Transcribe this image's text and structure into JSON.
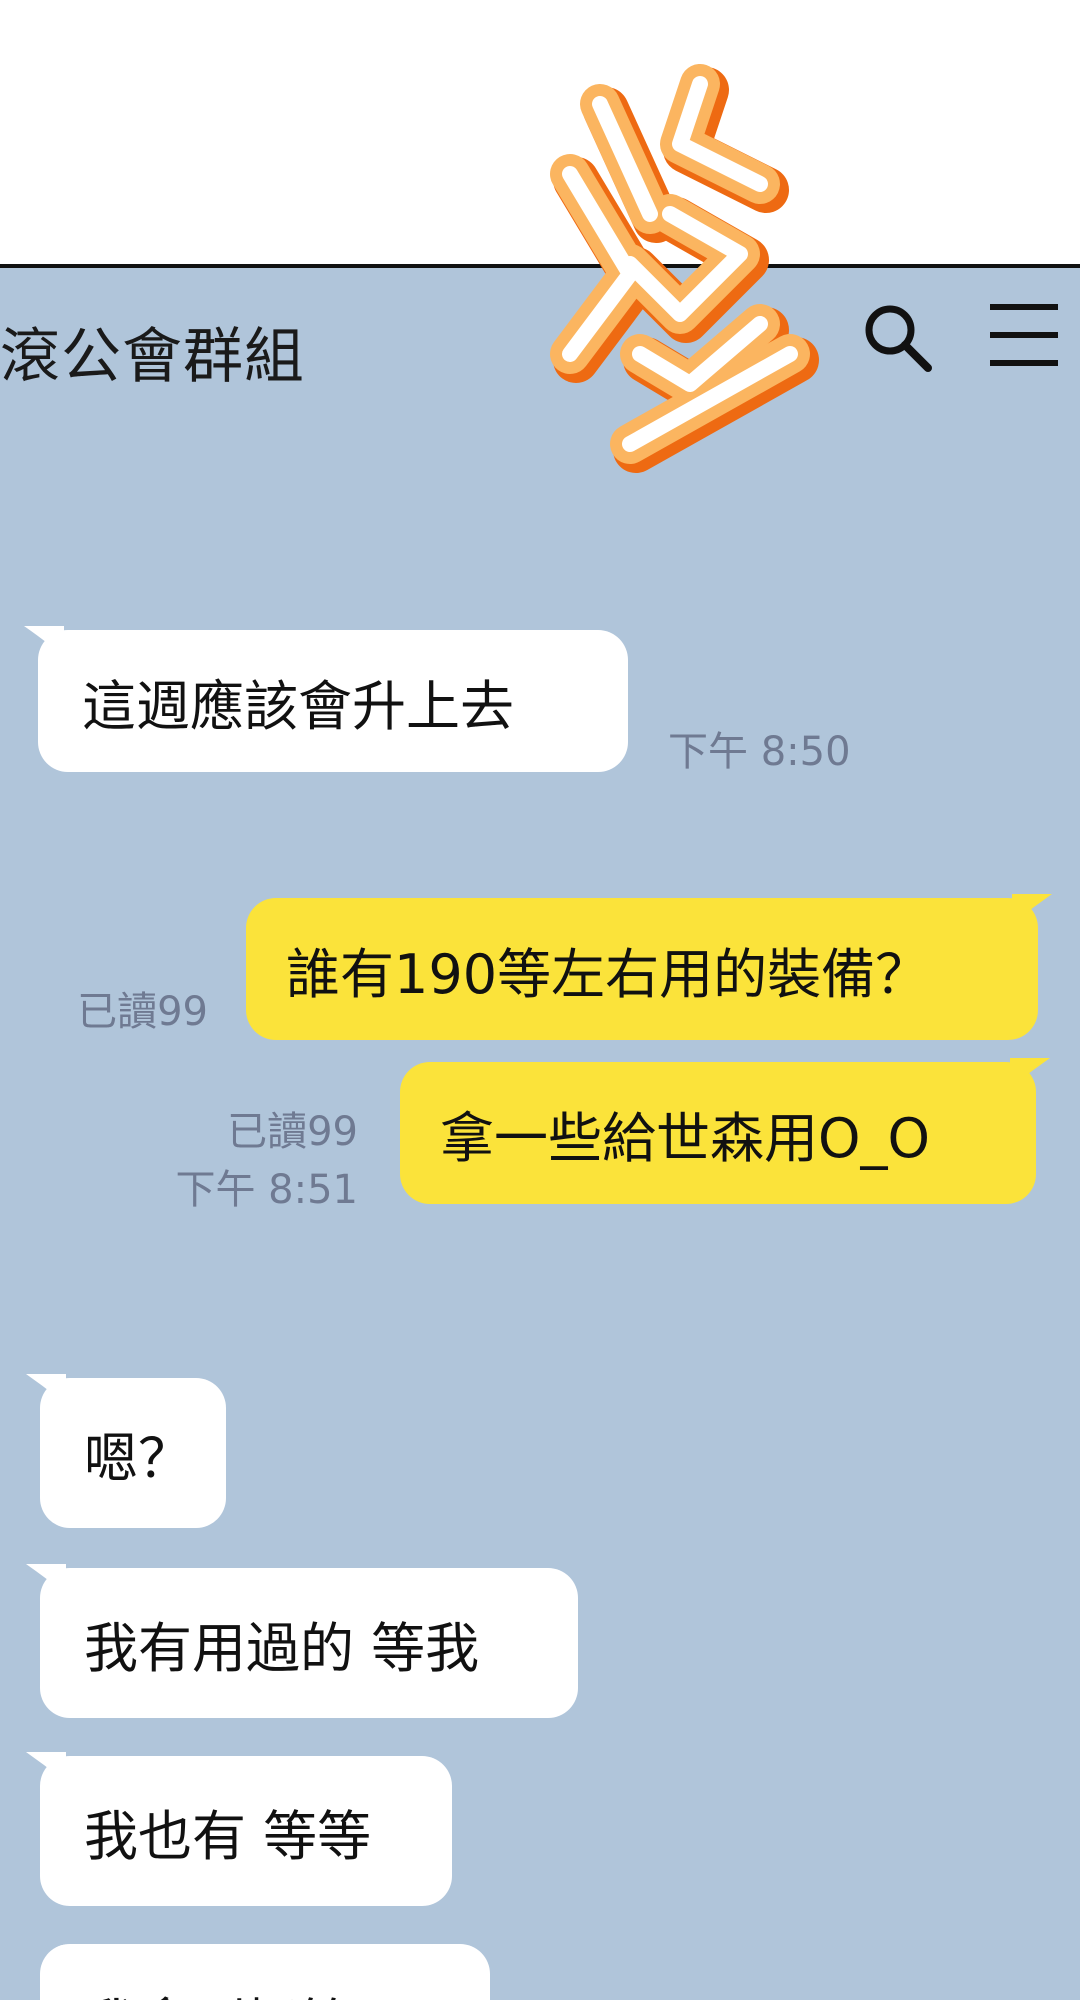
{
  "header": {
    "title": "滾公會群組",
    "search_icon": "search-icon",
    "menu_icon": "hamburger-menu-icon"
  },
  "sound_effect": {
    "text": "登",
    "colors": {
      "fill": "#ffffff",
      "light": "#fbb560",
      "dark": "#ee6a12"
    }
  },
  "colors": {
    "chat_background": "#b0c5da",
    "incoming_bubble": "#ffffff",
    "outgoing_bubble": "#fbe33a",
    "meta_text": "#6f7a92"
  },
  "messages": [
    {
      "direction": "in",
      "text": "這週應該會升上去",
      "time": "下午 8:50"
    },
    {
      "direction": "out",
      "text": "誰有190等左右用的裝備？",
      "read": "已讀99"
    },
    {
      "direction": "out",
      "text": "拿一些給世森用O_O",
      "read": "已讀99",
      "time": "下午 8:51"
    },
    {
      "direction": "in",
      "text": "嗯？"
    },
    {
      "direction": "in",
      "text": "我有用過的 等我"
    },
    {
      "direction": "in",
      "text": "我也有 等等"
    },
    {
      "direction": "in",
      "text": "我拿到極管了"
    }
  ]
}
